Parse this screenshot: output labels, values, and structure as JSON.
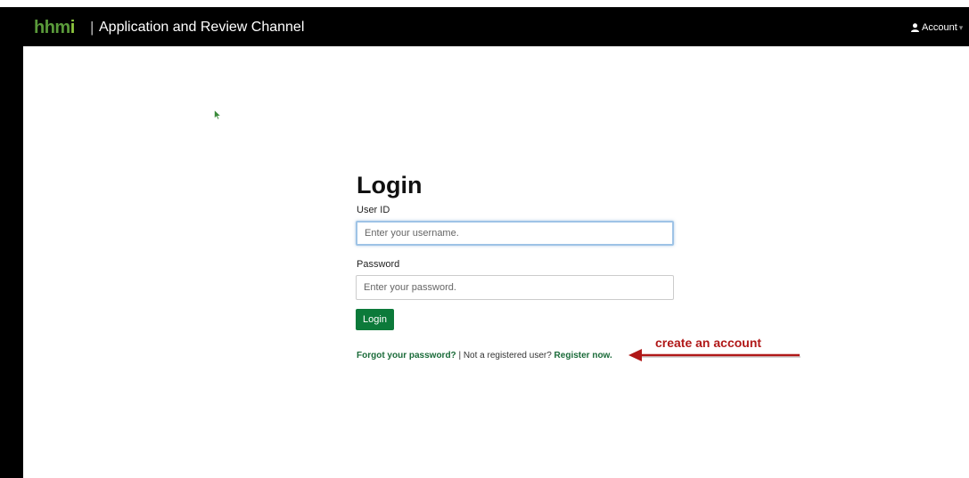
{
  "header": {
    "logo_main": "hhm",
    "logo_accent": "i",
    "separator": "|",
    "app_title": "Application and Review Channel",
    "account_label": "Account",
    "account_caret": "▾",
    "icons": {
      "account": "user-icon",
      "caret": "chevron-down-icon"
    },
    "colors": {
      "background": "#000000",
      "logo": "#5a9a3a",
      "logo_accent": "#8dc63f"
    }
  },
  "login_form": {
    "heading": "Login",
    "user_id_label": "User ID",
    "user_id_placeholder": "Enter your username.",
    "password_label": "Password",
    "password_placeholder": "Enter your password.",
    "submit_label": "Login",
    "colors": {
      "button": "#0c7a3a",
      "link": "#1a6b39",
      "focus_border": "#9ec3e6"
    }
  },
  "links": {
    "forgot_password": "Forgot your password?",
    "separator": " | Not a registered user? ",
    "register": "Register now."
  },
  "annotation": {
    "text": "create an account",
    "color": "#b01818",
    "icon": "arrow-left-icon"
  },
  "cursor": {
    "icon": "mouse-pointer-icon",
    "color": "#3a8a3a"
  }
}
